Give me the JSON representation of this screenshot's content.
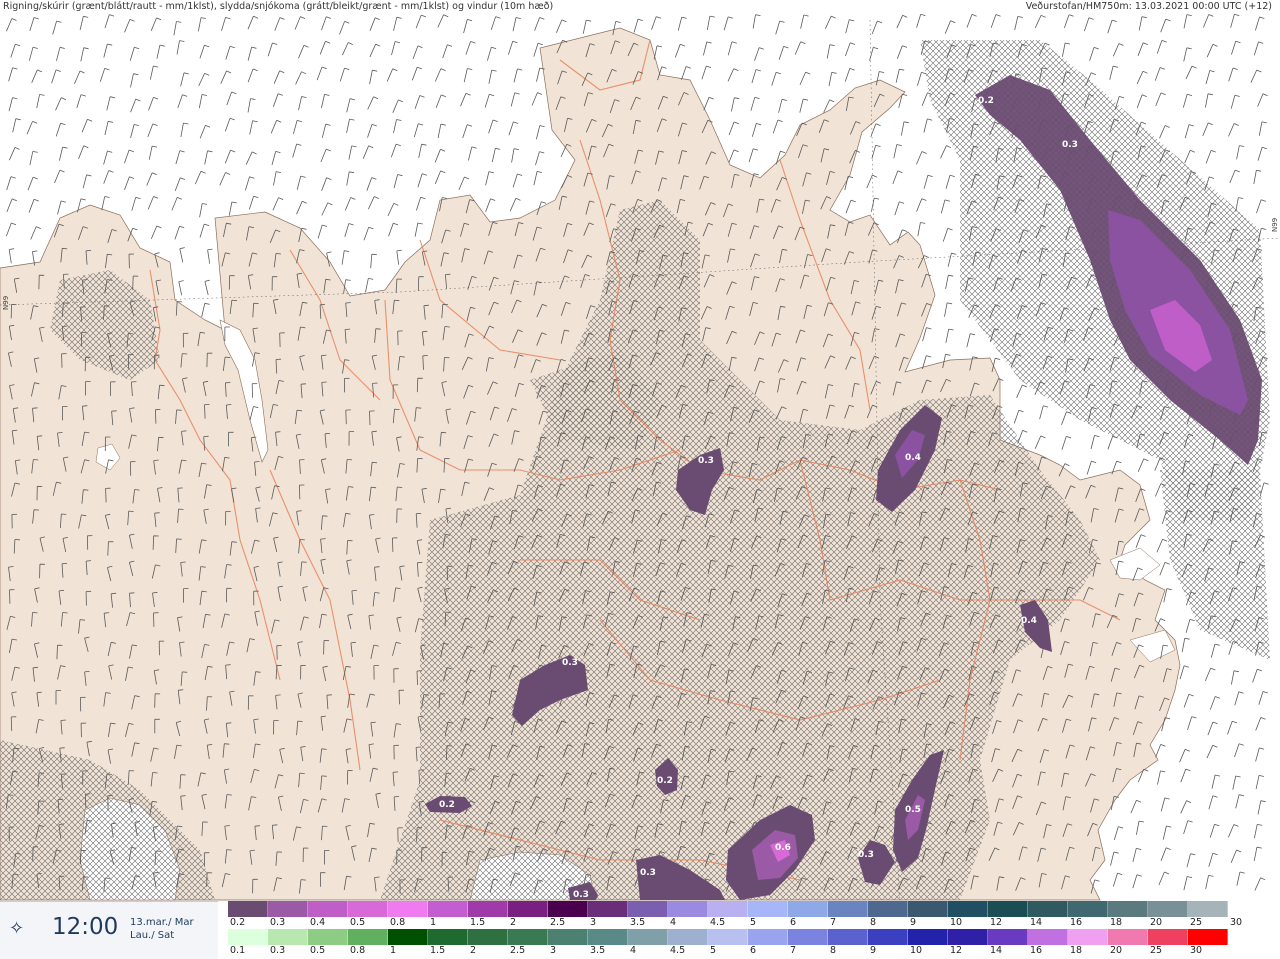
{
  "header": {
    "left_text": "Rigning/skúrir (grænt/blátt/rautt - mm/1klst), slydda/snjókoma (grátt/bleikt/grænt - mm/1klst) og vindur (10m hæð)",
    "right_text": "Veðurstofan/HM750m: 13.03.2021 00:00 UTC (+12)"
  },
  "map_edge_labels": {
    "left": "N99",
    "right": "N99"
  },
  "time_panel": {
    "icon": "compass-star-icon",
    "time": "12:00",
    "date_line1": "13.mar./ Mar",
    "date_line2": "Lau./ Sat"
  },
  "map_labels": [
    "0.2",
    "0.3",
    "0.3",
    "0.4",
    "0.4",
    "0.3",
    "0.2",
    "0.2",
    "0.5",
    "0.6",
    "0.3",
    "0.3",
    "0.3"
  ],
  "legend": {
    "snow": {
      "ticks": [
        "0.2",
        "0.3",
        "0.4",
        "0.5",
        "0.8",
        "1",
        "1.5",
        "2",
        "2.5",
        "3",
        "3.5",
        "4",
        "4.5",
        "5",
        "6",
        "7",
        "8",
        "9",
        "10",
        "12",
        "14",
        "16",
        "18",
        "20",
        "25",
        "30"
      ],
      "colors": [
        "#6a4c72",
        "#9a5aa6",
        "#c05ec8",
        "#d86ad8",
        "#f07af0",
        "#c25ed0",
        "#a03aa8",
        "#7a1f82",
        "#4a004f",
        "#6a2d7a",
        "#7a5fb0",
        "#9a8ae0",
        "#b8b0f0",
        "#a6b6f8",
        "#8fa8e8",
        "#6a84c0",
        "#4e6890",
        "#3a5870",
        "#204e62",
        "#1b4d55",
        "#2e5a60",
        "#406870",
        "#5a7a80",
        "#7a9098",
        "#a4b4b8",
        "#ffffff"
      ]
    },
    "rain": {
      "ticks": [
        "0.1",
        "0.3",
        "0.5",
        "0.8",
        "1",
        "1.5",
        "2",
        "2.5",
        "3",
        "3.5",
        "4",
        "4.5",
        "5",
        "6",
        "7",
        "8",
        "9",
        "10",
        "12",
        "14",
        "16",
        "18",
        "20",
        "25",
        "30"
      ],
      "colors": [
        "#dcffdc",
        "#b8e8b0",
        "#8ccc84",
        "#60b060",
        "#005000",
        "#1f6a2e",
        "#2f7040",
        "#3a7a52",
        "#4c8070",
        "#5a8a88",
        "#7fa0a8",
        "#9eb0d0",
        "#b8c0f0",
        "#9aa4ee",
        "#7a84e0",
        "#5a62d0",
        "#3a40c0",
        "#2222aa",
        "#3020a8",
        "#6a3ac0",
        "#c070e0",
        "#f0a0f0",
        "#f07ab0",
        "#f04060",
        "#ff0000"
      ]
    }
  }
}
